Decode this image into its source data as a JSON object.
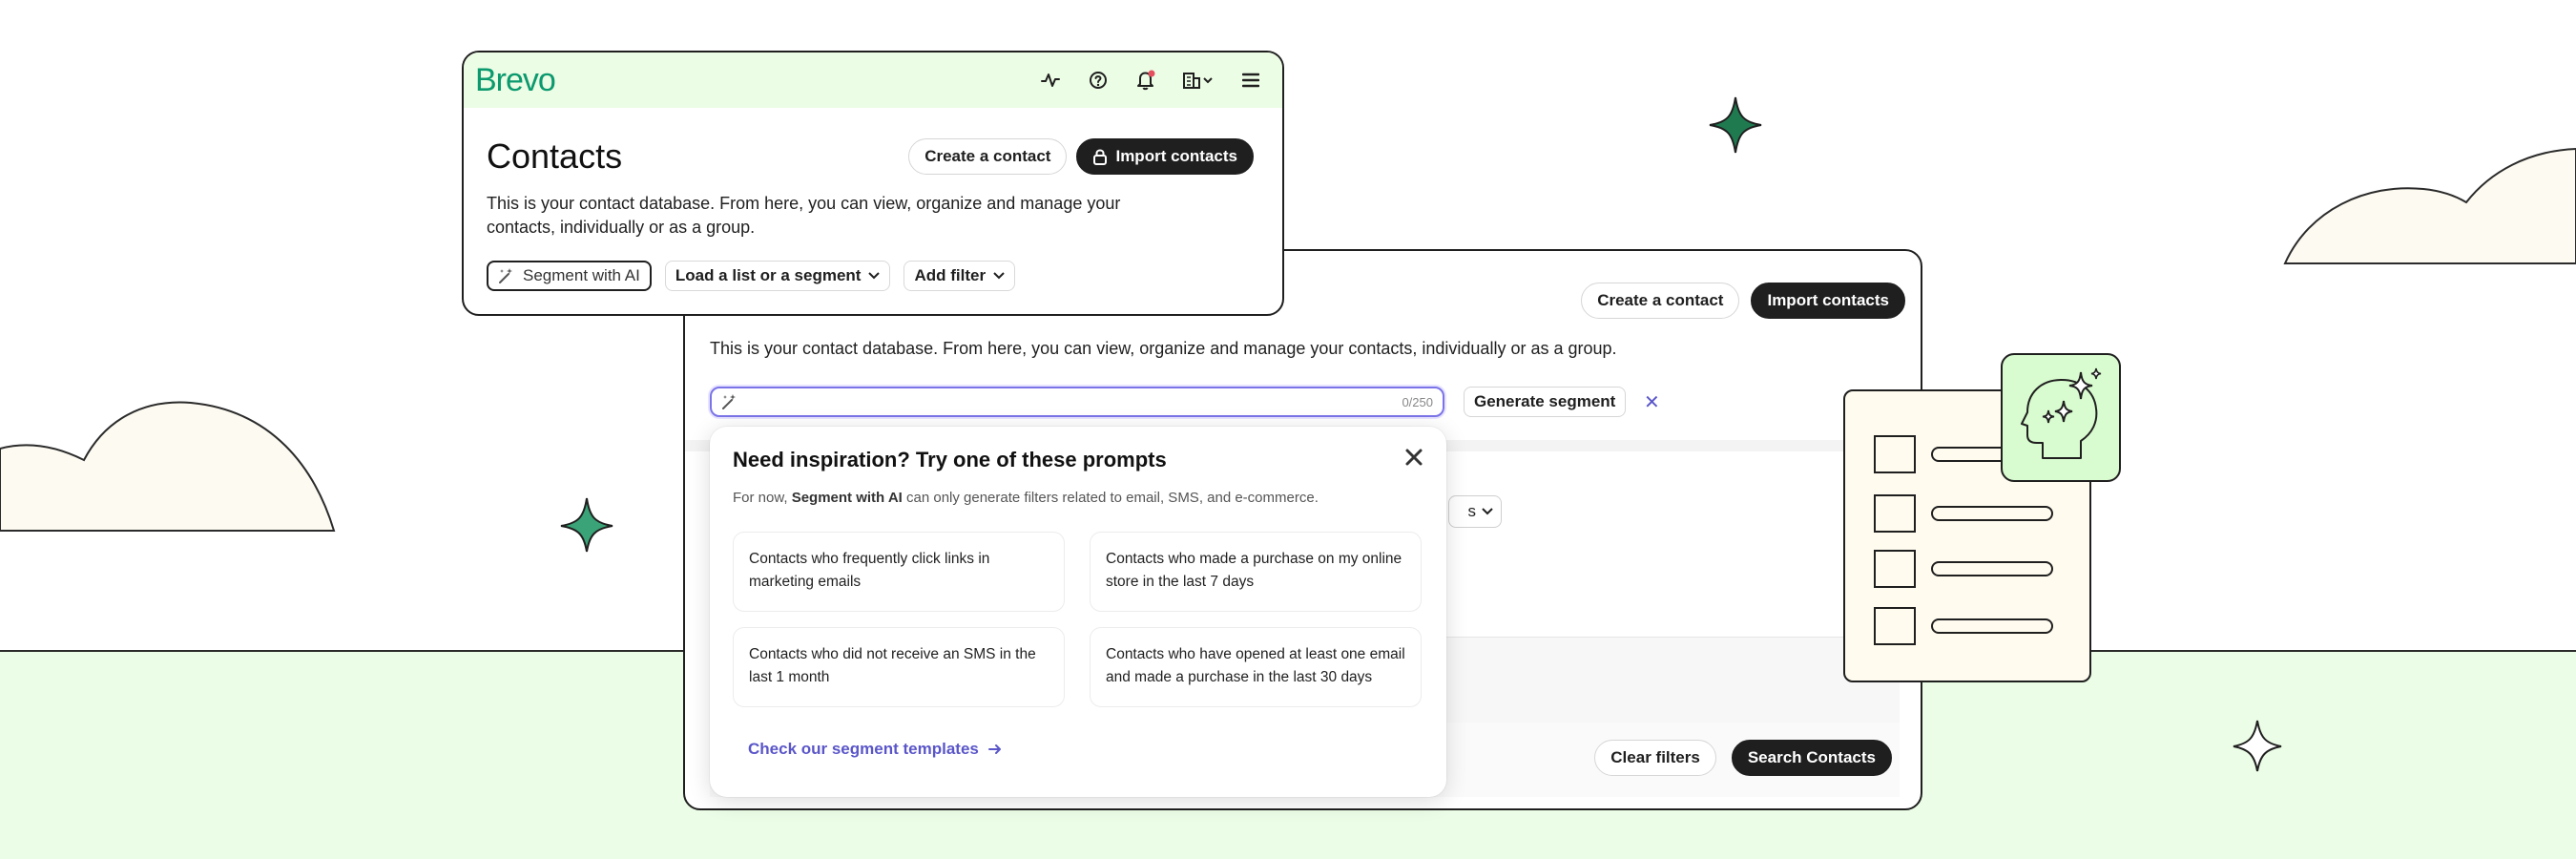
{
  "brand": {
    "logo": "Brevo"
  },
  "front_card": {
    "title": "Contacts",
    "create_button": "Create a contact",
    "import_button": "Import contacts",
    "description": "This is your contact database. From here, you can view, organize and manage your contacts, individually or as a group.",
    "filters": {
      "segment_ai": "Segment with AI",
      "load_list": "Load a list or a segment",
      "add_filter": "Add filter"
    }
  },
  "back_card": {
    "create_button": "Create a contact",
    "import_button": "Import contacts",
    "description": "This is your contact database. From here, you can view, organize and manage your contacts, individually or as a group.",
    "ai_input": {
      "counter": "0/250",
      "value": ""
    },
    "generate_button": "Generate segment",
    "partial_chip": "s",
    "clear_button": "Clear filters",
    "search_button": "Search Contacts"
  },
  "popover": {
    "title": "Need inspiration? Try one of these prompts",
    "note_prefix": "For now, ",
    "note_bold": "Segment with AI",
    "note_suffix": " can only generate filters related to email, SMS, and e-commerce.",
    "prompts": [
      "Contacts who frequently click links in marketing emails",
      "Contacts who made a purchase on my online store in the last 7 days",
      "Contacts who did not receive an SMS in the last 1 month",
      "Contacts who have opened at least one email and made a purchase in the last 30 days"
    ],
    "templates_link": "Check our segment templates"
  },
  "colors": {
    "brand_green": "#0b996e",
    "topbar_bg": "#ecfde5",
    "dark_button": "#1f1f1f",
    "link_purple": "#5a56c9",
    "input_focus": "#7b74e8",
    "ground": "#ebfde6",
    "sparkle_green": "#1f7a50"
  },
  "icons": [
    "activity-icon",
    "help-icon",
    "bell-icon",
    "building-icon",
    "menu-icon",
    "lock-icon",
    "magic-wand-icon",
    "chevron-down-icon",
    "close-icon",
    "arrow-right-icon",
    "sparkle-icon",
    "ai-head-icon"
  ]
}
